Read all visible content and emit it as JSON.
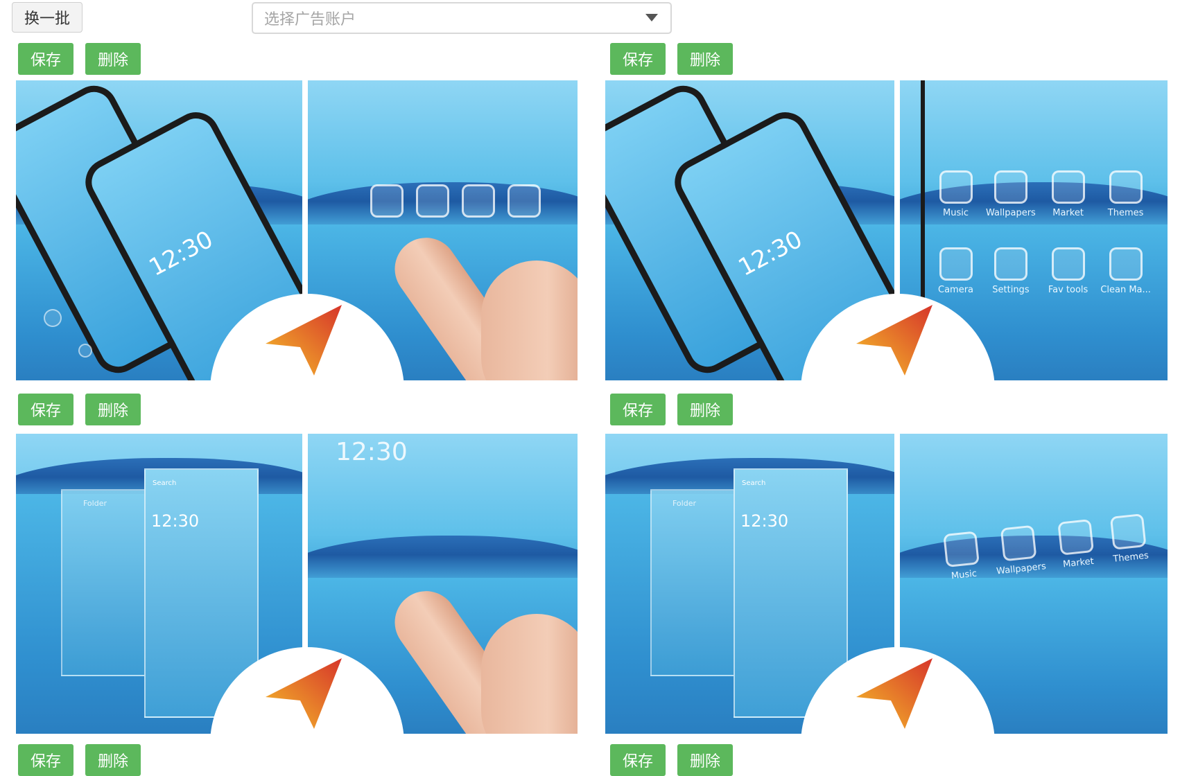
{
  "toolbar": {
    "refresh_label": "换一批",
    "account_placeholder": "选择广告账户"
  },
  "cards": [
    {
      "save_label": "保存",
      "delete_label": "删除"
    },
    {
      "save_label": "保存",
      "delete_label": "删除"
    },
    {
      "save_label": "保存",
      "delete_label": "删除"
    },
    {
      "save_label": "保存",
      "delete_label": "删除"
    },
    {
      "save_label": "保存",
      "delete_label": "删除"
    },
    {
      "save_label": "保存",
      "delete_label": "删除"
    }
  ],
  "images": {
    "time_text": "12:30",
    "search_text": "Search",
    "folder_text": "Folder",
    "icon_labels": [
      "Music",
      "Wallpapers",
      "Market",
      "Themes",
      "Camera",
      "Settings",
      "Fav tools",
      "Clean Ma..."
    ]
  },
  "colors": {
    "button_green": "#5cb85c",
    "water_blue": "#3fa6da",
    "logo_red": "#d8452d",
    "logo_orange": "#f6a623"
  }
}
